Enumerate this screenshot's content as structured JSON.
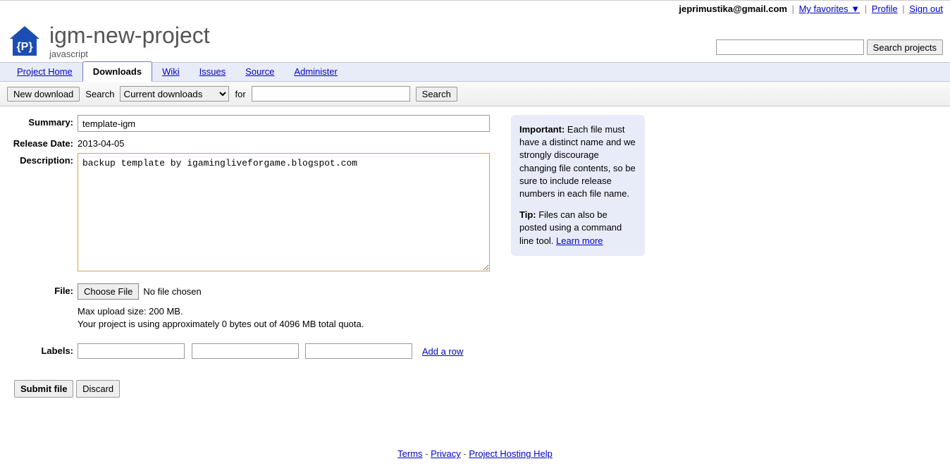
{
  "user": {
    "email": "jeprimustika@gmail.com",
    "favorites": "My favorites",
    "profile": "Profile",
    "signout": "Sign out"
  },
  "project": {
    "name": "igm-new-project",
    "subtitle": "javascript"
  },
  "search_projects_btn": "Search projects",
  "tabs": {
    "home": "Project Home",
    "downloads": "Downloads",
    "wiki": "Wiki",
    "issues": "Issues",
    "source": "Source",
    "admin": "Administer"
  },
  "subbar": {
    "new_download": "New download",
    "search_label": "Search",
    "filter_selected": "Current downloads",
    "for_label": "for",
    "search_btn": "Search"
  },
  "form": {
    "summary_label": "Summary:",
    "summary_value": "template-igm",
    "release_label": "Release Date:",
    "release_value": "2013-04-05",
    "description_label": "Description:",
    "description_value": "backup template by igaminglivefor­game.blogspot.com",
    "file_label": "File:",
    "choose_file": "Choose File",
    "no_file": "No file chosen",
    "max_note": "Max upload size: 200 MB.",
    "quota_note": "Your project is using approximately 0 bytes out of 4096 MB total quota.",
    "labels_label": "Labels:",
    "add_row": "Add a row",
    "submit": "Submit file",
    "discard": "Discard"
  },
  "info": {
    "important_label": "Important:",
    "important_text": " Each file must have a distinct name and we strongly discourage changing file contents, so be sure to include release numbers in each file name.",
    "tip_label": "Tip:",
    "tip_text": " Files can also be posted using a command line tool. ",
    "learn_more": "Learn more"
  },
  "footer": {
    "terms": "Terms",
    "privacy": "Privacy",
    "help": "Project Hosting Help"
  }
}
